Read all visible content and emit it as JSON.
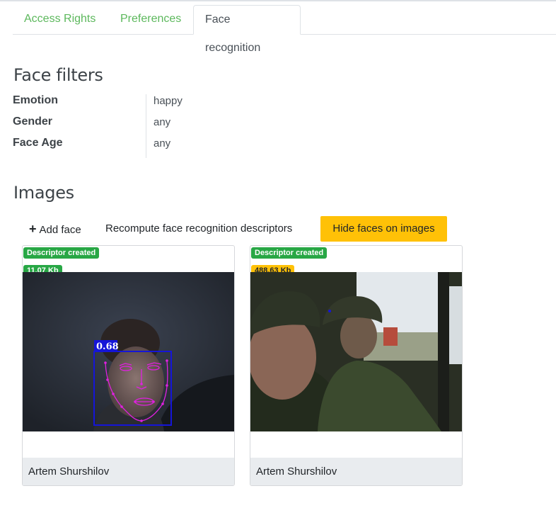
{
  "tabs": [
    {
      "label": "Access Rights",
      "active": false
    },
    {
      "label": "Preferences",
      "active": false
    },
    {
      "label": "Face recognition",
      "active": true
    }
  ],
  "filters": {
    "heading": "Face filters",
    "rows": [
      {
        "label": "Emotion",
        "value": "happy"
      },
      {
        "label": "Gender",
        "value": "any"
      },
      {
        "label": "Face Age",
        "value": "any"
      }
    ]
  },
  "images": {
    "heading": "Images",
    "toolbar": {
      "add_icon": "plus-icon",
      "add_label": "Add face",
      "recompute_label": "Recompute face recognition descriptors",
      "hide_label": "Hide faces on images"
    },
    "cards": [
      {
        "descriptor_badge": "Descriptor created",
        "size_badge": "11.07 Kb",
        "size_status": "green",
        "face_score": "0.68",
        "name": "Artem Shurshilov"
      },
      {
        "descriptor_badge": "Descriptor created",
        "size_badge": "488.63 Kb",
        "size_status": "yellow",
        "name": "Artem Shurshilov"
      }
    ]
  },
  "colors": {
    "tab_link": "#5cb85c",
    "success": "#28a745",
    "warning": "#ffc107",
    "face_box": "#1515d8",
    "landmarks": "#e020e0"
  }
}
